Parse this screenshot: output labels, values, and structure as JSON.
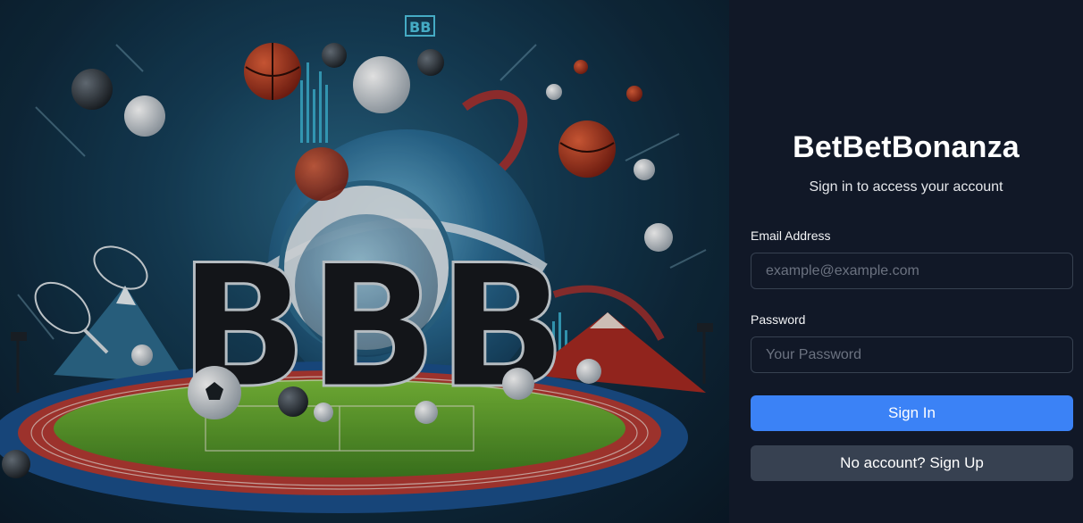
{
  "hero": {
    "alt": "Sports themed BetBetBonanza artwork",
    "logo_letters": "BBB",
    "badge_letters": "BB"
  },
  "login": {
    "title": "BetBetBonanza",
    "subtitle": "Sign in to access your account",
    "email_label": "Email Address",
    "email_placeholder": "example@example.com",
    "email_value": "",
    "password_label": "Password",
    "password_placeholder": "Your Password",
    "password_value": "",
    "signin_label": "Sign In",
    "signup_label": "No account? Sign Up"
  },
  "colors": {
    "panel_bg": "#111827",
    "input_border": "#374151",
    "primary": "#3b82f6",
    "secondary": "#374151"
  }
}
